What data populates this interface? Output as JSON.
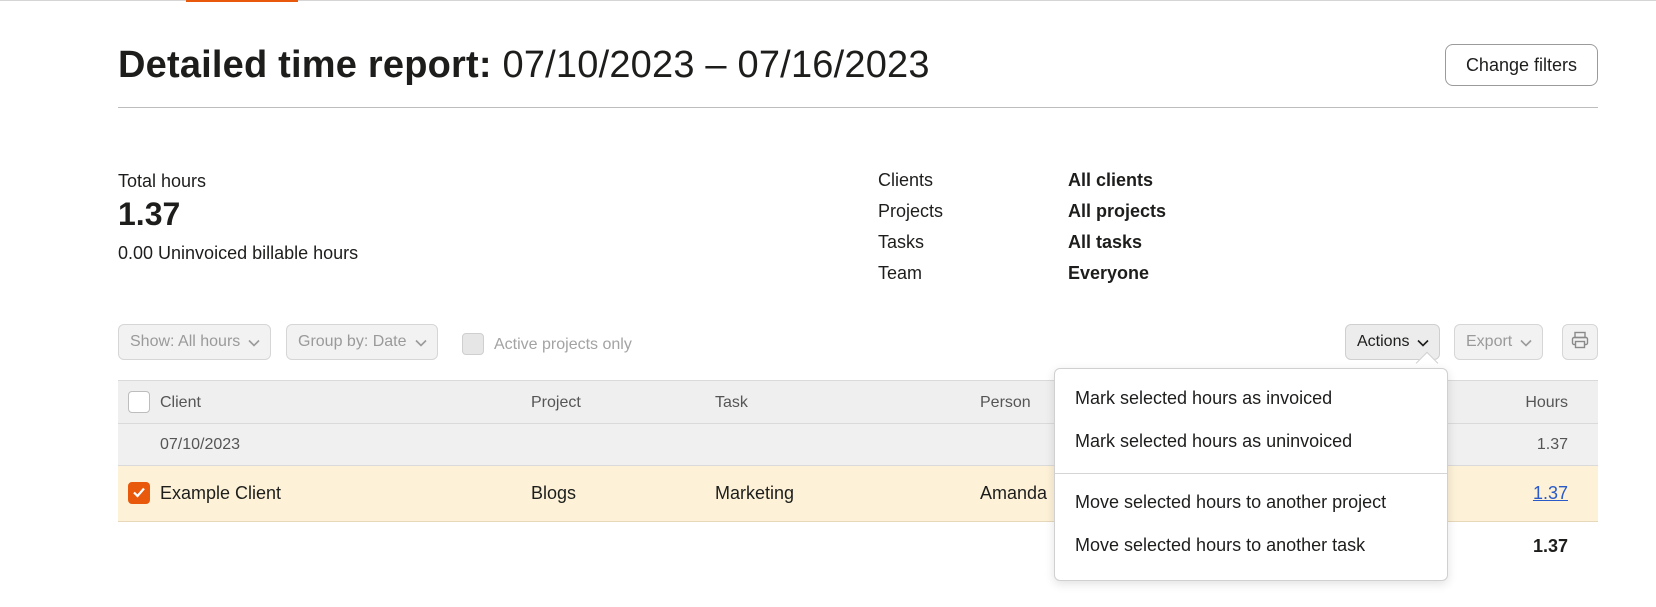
{
  "header": {
    "title_prefix": "Detailed time report:",
    "title_range": "07/10/2023 – 07/16/2023",
    "change_filters_label": "Change filters"
  },
  "summary": {
    "total_label": "Total hours",
    "total_value": "1.37",
    "uninvoiced": "0.00 Uninvoiced billable hours"
  },
  "filters": [
    {
      "key": "Clients",
      "value": "All clients"
    },
    {
      "key": "Projects",
      "value": "All projects"
    },
    {
      "key": "Tasks",
      "value": "All tasks"
    },
    {
      "key": "Team",
      "value": "Everyone"
    }
  ],
  "toolbar": {
    "show_label": "Show: All hours",
    "group_label": "Group by: Date",
    "active_only_label": "Active projects only",
    "actions_label": "Actions",
    "export_label": "Export"
  },
  "table": {
    "columns": {
      "client": "Client",
      "project": "Project",
      "task": "Task",
      "person": "Person",
      "hours": "Hours"
    },
    "group": {
      "date": "07/10/2023",
      "hours": "1.37"
    },
    "row": {
      "client": "Example Client",
      "project": "Blogs",
      "task": "Marketing",
      "person": "Amanda",
      "hours": "1.37",
      "checked": true
    },
    "total_hours": "1.37"
  },
  "actions_menu": {
    "items": [
      "Mark selected hours as invoiced",
      "Mark selected hours as uninvoiced",
      "Move selected hours to another project",
      "Move selected hours to another task"
    ]
  },
  "colors": {
    "accent": "#e8590c",
    "link": "#2a5ac9",
    "row_highlight": "#fdf2d8"
  }
}
